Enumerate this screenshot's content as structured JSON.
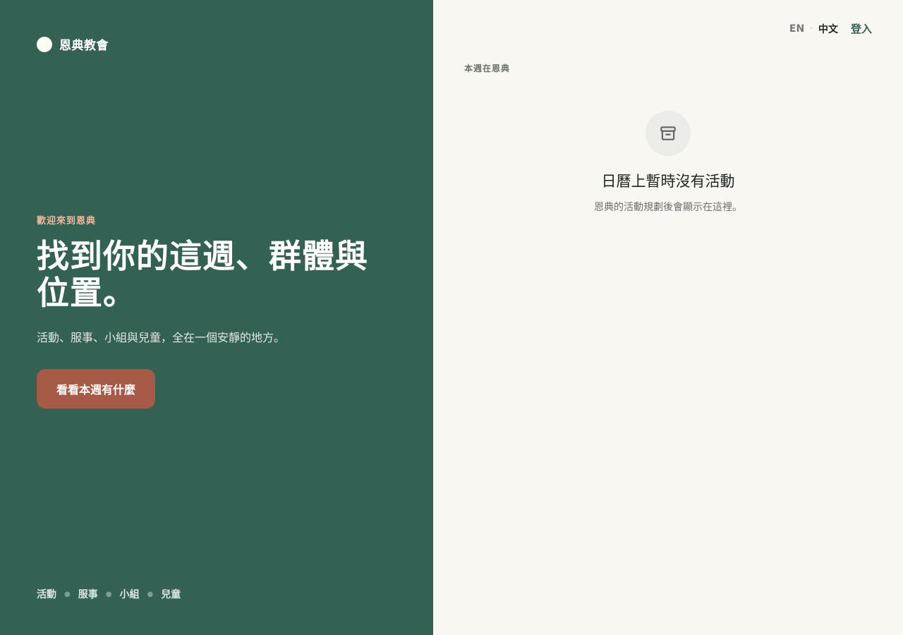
{
  "brand": {
    "name": "恩典教會"
  },
  "hero": {
    "eyebrow": "歡迎來到恩典",
    "title": "找到你的這週、群體與位置。",
    "subtitle": "活動、服事、小組與兒童，全在一個安靜的地方。",
    "cta_label": "看看本週有什麼"
  },
  "footer_nav": {
    "items": [
      "活動",
      "服事",
      "小組",
      "兒童"
    ]
  },
  "topbar": {
    "lang_en": "EN",
    "lang_separator": "·",
    "lang_zh": "中文",
    "login_label": "登入"
  },
  "side": {
    "section_label": "本週在恩典",
    "empty_title": "日曆上暫時沒有活動",
    "empty_desc": "恩典的活動規劃後會顯示在這裡。",
    "empty_icon": "archive-box-icon"
  },
  "colors": {
    "hero_bg": "#336153",
    "accent": "#a65a46",
    "eyebrow": "#f1b99e",
    "side_bg": "#f8f7f2"
  }
}
